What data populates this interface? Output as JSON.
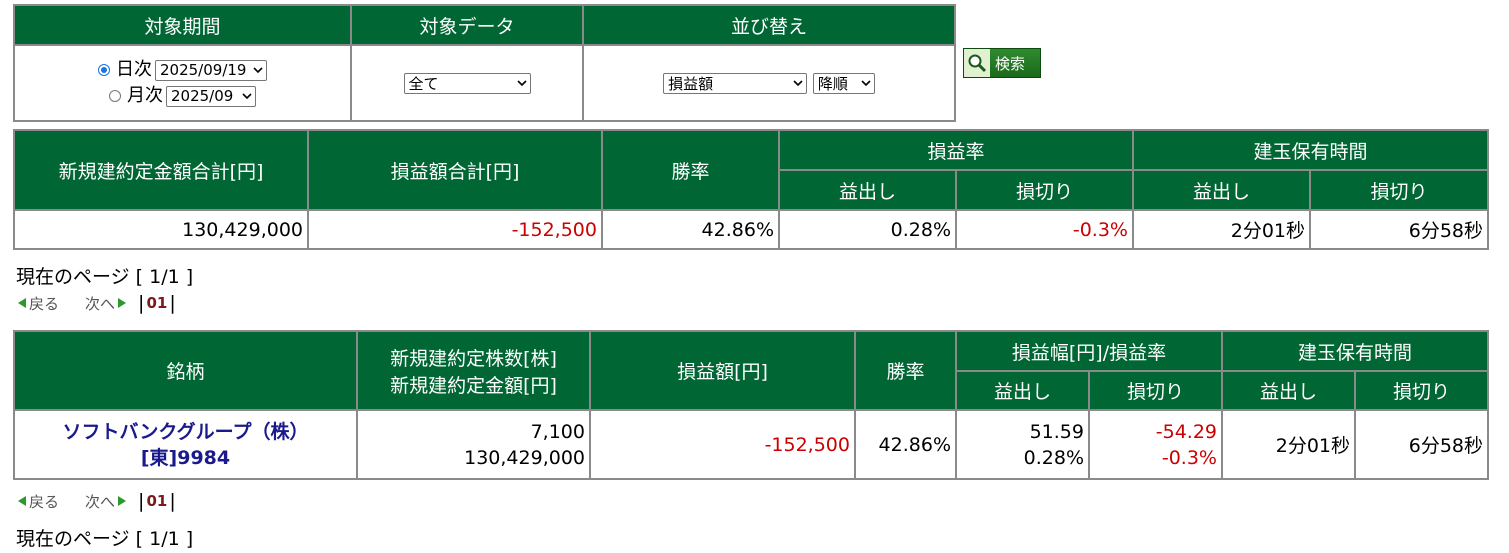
{
  "search": {
    "period_header": "対象期間",
    "data_header": "対象データ",
    "sort_header": "並び替え",
    "daily_label": "日次",
    "daily_value": "2025/09/19",
    "monthly_label": "月次",
    "monthly_value": "2025/09",
    "data_value": "全て",
    "sort_value": "損益額",
    "order_value": "降順",
    "button_label": "検索"
  },
  "summary": {
    "headers": {
      "total_amount": "新規建約定金額合計[円]",
      "total_pnl": "損益額合計[円]",
      "win_rate": "勝率",
      "pnl_rate": "損益率",
      "holding_time": "建玉保有時間",
      "profit": "益出し",
      "loss": "損切り"
    },
    "values": {
      "total_amount": "130,429,000",
      "total_pnl": "-152,500",
      "win_rate": "42.86%",
      "rate_profit": "0.28%",
      "rate_loss": "-0.3%",
      "time_profit": "2分01秒",
      "time_loss": "6分58秒"
    }
  },
  "pager": {
    "current_page": "現在のページ [ 1/1 ]",
    "prev": "戻る",
    "next": "次へ",
    "page": "01"
  },
  "detail": {
    "headers": {
      "stock": "銘柄",
      "shares_line1": "新規建約定株数[株]",
      "shares_line2": "新規建約定金額[円]",
      "pnl": "損益額[円]",
      "win_rate": "勝率",
      "range_rate": "損益幅[円]/損益率",
      "holding_time": "建玉保有時間",
      "profit": "益出し",
      "loss": "損切り"
    },
    "rows": [
      {
        "name": "ソフトバンクグループ（株）",
        "code": "[東]9984",
        "shares": "7,100",
        "amount": "130,429,000",
        "pnl": "-152,500",
        "win_rate": "42.86%",
        "profit_range": "51.59",
        "profit_rate": "0.28%",
        "loss_range": "-54.29",
        "loss_rate": "-0.3%",
        "time_profit": "2分01秒",
        "time_loss": "6分58秒"
      }
    ]
  },
  "colors": {
    "header_bg": "#006633",
    "negative": "#cc0000",
    "link": "#1a1a8c"
  }
}
